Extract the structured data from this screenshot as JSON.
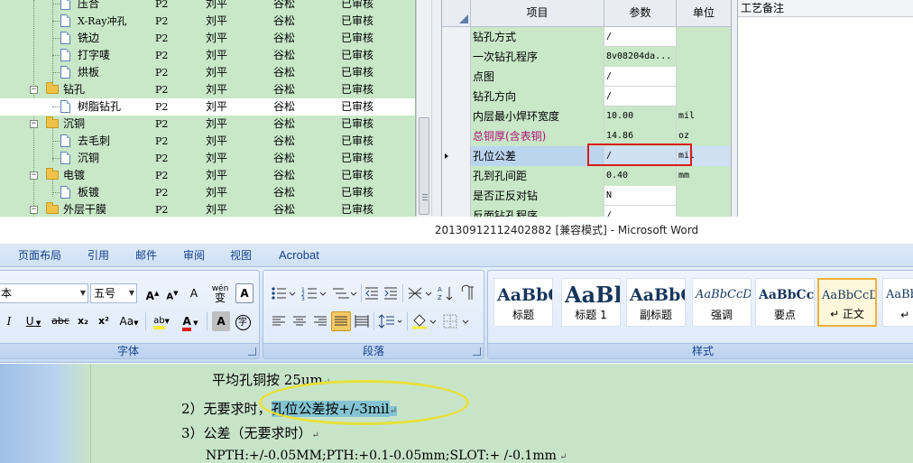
{
  "process_tree": {
    "rows": [
      {
        "label": "压合",
        "type": "leaf",
        "c1": "P2",
        "c2": "刘平",
        "c3": "谷松",
        "c4": "已审核"
      },
      {
        "label": "X-Ray冲孔",
        "type": "leaf",
        "c1": "P2",
        "c2": "刘平",
        "c3": "谷松",
        "c4": "已审核"
      },
      {
        "label": "铣边",
        "type": "leaf",
        "c1": "P2",
        "c2": "刘平",
        "c3": "谷松",
        "c4": "已审核"
      },
      {
        "label": "打字唛",
        "type": "leaf",
        "c1": "P2",
        "c2": "刘平",
        "c3": "谷松",
        "c4": "已审核"
      },
      {
        "label": "烘板",
        "type": "leaf",
        "c1": "P2",
        "c2": "刘平",
        "c3": "谷松",
        "c4": "已审核"
      },
      {
        "label": "钻孔",
        "type": "folder",
        "c1": "P2",
        "c2": "刘平",
        "c3": "谷松",
        "c4": "已审核"
      },
      {
        "label": "树脂钻孔",
        "type": "leaf",
        "selected": true,
        "c1": "P2",
        "c2": "刘平",
        "c3": "谷松",
        "c4": "已审核"
      },
      {
        "label": "沉铜",
        "type": "folder",
        "c1": "P2",
        "c2": "刘平",
        "c3": "谷松",
        "c4": "已审核"
      },
      {
        "label": "去毛刺",
        "type": "leaf",
        "c1": "P2",
        "c2": "刘平",
        "c3": "谷松",
        "c4": "已审核"
      },
      {
        "label": "沉铜",
        "type": "leaf",
        "c1": "P2",
        "c2": "刘平",
        "c3": "谷松",
        "c4": "已审核"
      },
      {
        "label": "电镀",
        "type": "folder",
        "c1": "P2",
        "c2": "刘平",
        "c3": "谷松",
        "c4": "已审核"
      },
      {
        "label": "板镀",
        "type": "leaf",
        "c1": "P2",
        "c2": "刘平",
        "c3": "谷松",
        "c4": "已审核"
      },
      {
        "label": "外层干膜",
        "type": "folder",
        "c1": "P2",
        "c2": "刘平",
        "c3": "谷松",
        "c4": "已审核"
      }
    ]
  },
  "param_grid": {
    "headers": {
      "item": "项目",
      "param": "参数",
      "unit": "单位"
    },
    "rows": [
      {
        "item": "钻孔方式",
        "param": "/",
        "unit": ""
      },
      {
        "item": "一次钻孔程序",
        "param": "8v08204da...",
        "unit": ""
      },
      {
        "item": "点图",
        "param": "/",
        "unit": ""
      },
      {
        "item": "钻孔方向",
        "param": "/",
        "unit": ""
      },
      {
        "item": "内层最小焊环宽度",
        "param": "10.00",
        "unit": "mil"
      },
      {
        "item": "总铜厚(含表铜)",
        "param": "14.86",
        "unit": "oz",
        "item_color": "#b0107a"
      },
      {
        "item": "孔位公差",
        "param": "/",
        "unit": "mil",
        "active": true
      },
      {
        "item": "孔到孔间距",
        "param": "0.40",
        "unit": "mm"
      },
      {
        "item": "是否正反对钻",
        "param": "N",
        "unit": ""
      },
      {
        "item": "反面钻孔程序",
        "param": "/",
        "unit": ""
      }
    ]
  },
  "notes_panel": {
    "title": "工艺备注"
  },
  "word": {
    "title": "20130912112402882 [兼容模式] - Microsoft Word",
    "menu_tabs": [
      "页面布局",
      "引用",
      "邮件",
      "审阅",
      "视图",
      "Acrobat"
    ],
    "font": {
      "font_name_fragment": "本",
      "font_size": "五号",
      "group_label": "字体",
      "buttons": {
        "grow": "A",
        "shrink": "A",
        "clear": "A",
        "phonetic": "wén",
        "border": "A",
        "italic": "I",
        "underline": "U",
        "strike": "abc",
        "sub": "x₂",
        "sup": "x²",
        "case": "Aa",
        "highlight": "ab",
        "color": "A",
        "shade": "A",
        "enclose": "字"
      }
    },
    "paragraph": {
      "group_label": "段落"
    },
    "styles": {
      "group_label": "样式",
      "items": [
        {
          "sample": "AaBbC",
          "name": "标题"
        },
        {
          "sample": "AaBl",
          "name": "标题 1"
        },
        {
          "sample": "AaBbC",
          "name": "副标题"
        },
        {
          "sample": "AaBbCcDd",
          "name": "强调"
        },
        {
          "sample": "AaBbCcD",
          "name": "要点"
        },
        {
          "sample": "AaBbCcDd",
          "name": "↵ 正文",
          "selected": true
        },
        {
          "sample": "AaBb",
          "name": "↵ 无"
        }
      ]
    }
  },
  "document": {
    "line1": "平均孔铜按 25um",
    "line2_prefix": "2）无要求时，",
    "line2_highlight": "孔位公差按+/-3mil",
    "line3": "3）公差（无要求时）",
    "line4": "NPTH:+/-0.05MM;PTH:+0.1-0.05mm;SLOT:+  /-0.1mm",
    "para_mark": "↵"
  },
  "colors": {
    "tree_bg": "#c8e8c8",
    "annotation_red": "#d81c1c",
    "annotation_yellow": "#e6e13a",
    "text_highlight": "#84c4d2",
    "ribbon_text": "#15428b"
  }
}
